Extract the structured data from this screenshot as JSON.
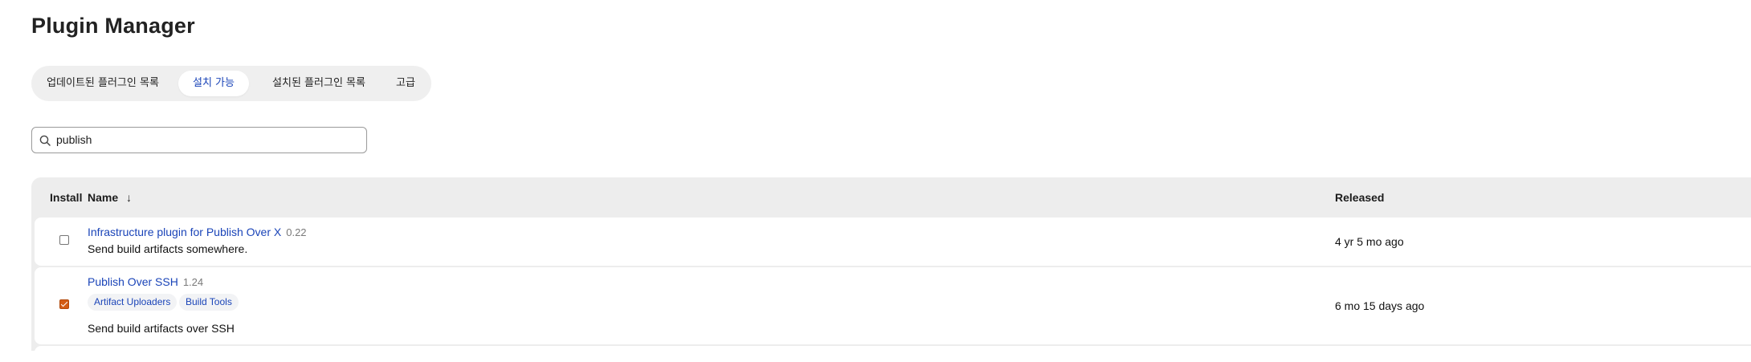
{
  "page": {
    "title": "Plugin Manager"
  },
  "tabs": [
    {
      "label": "업데이트된 플러그인 목록",
      "active": false
    },
    {
      "label": "설치 가능",
      "active": true
    },
    {
      "label": "설치된 플러그인 목록",
      "active": false
    },
    {
      "label": "고급",
      "active": false
    }
  ],
  "search": {
    "value": "publish",
    "icon": "search-icon"
  },
  "table": {
    "headers": {
      "install": "Install",
      "name": "Name",
      "sort_indicator": "↓",
      "released": "Released"
    },
    "rows": [
      {
        "name": "Infrastructure plugin for Publish Over X",
        "version": "0.22",
        "description": "Send build artifacts somewhere.",
        "released": "4 yr 5 mo ago",
        "checked": false,
        "tags": []
      },
      {
        "name": "Publish Over SSH",
        "version": "1.24",
        "description": "Send build artifacts over SSH",
        "released": "6 mo 15 days ago",
        "checked": true,
        "tags": [
          "Artifact Uploaders",
          "Build Tools"
        ]
      }
    ]
  },
  "colors": {
    "accent": "#1a44b8",
    "checkbox_checked": "#d35c14",
    "tab_bar": "#efefef",
    "table_header": "#ededed"
  }
}
